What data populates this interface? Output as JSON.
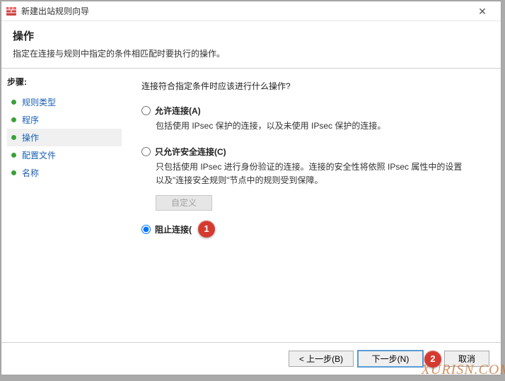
{
  "window": {
    "title": "新建出站规则向导"
  },
  "header": {
    "title": "操作",
    "subtitle": "指定在连接与规则中指定的条件相匹配时要执行的操作。"
  },
  "sidebar": {
    "label": "步骤:",
    "items": [
      {
        "label": "规则类型"
      },
      {
        "label": "程序"
      },
      {
        "label": "操作",
        "current": true
      },
      {
        "label": "配置文件"
      },
      {
        "label": "名称"
      }
    ]
  },
  "content": {
    "prompt": "连接符合指定条件时应该进行什么操作?",
    "options": [
      {
        "label": "允许连接(A)",
        "desc": "包括使用 IPsec 保护的连接，以及未使用 IPsec 保护的连接。",
        "checked": false
      },
      {
        "label": "只允许安全连接(C)",
        "desc": "只包括使用 IPsec 进行身份验证的连接。连接的安全性将依照 IPsec 属性中的设置以及\"连接安全规则\"节点中的规则受到保障。",
        "checked": false,
        "customize": "自定义"
      },
      {
        "label": "阻止连接(",
        "desc": "",
        "checked": true
      }
    ]
  },
  "footer": {
    "back": "< 上一步(B)",
    "next": "下一步(N)",
    "cancel": "取消"
  },
  "markers": {
    "m1": "1",
    "m2": "2"
  },
  "watermark": "XURISN.COM"
}
